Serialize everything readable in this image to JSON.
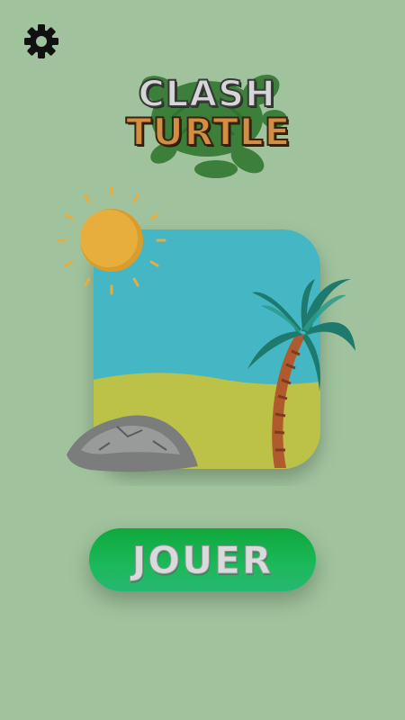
{
  "logo": {
    "line1": "CLASH",
    "line2": "TURTLE"
  },
  "play_button": {
    "label": "JOUER"
  },
  "icons": {
    "settings": "gear-icon",
    "logo_decoration": "turtle-icon",
    "sun": "sun-icon",
    "palm": "palm-tree-icon",
    "rock": "rock-icon"
  },
  "colors": {
    "background": "#a0c39d",
    "sky": "#45b6c4",
    "sand": "#bcc148",
    "sun": "#e7ae3e",
    "button": "#14ab47"
  }
}
